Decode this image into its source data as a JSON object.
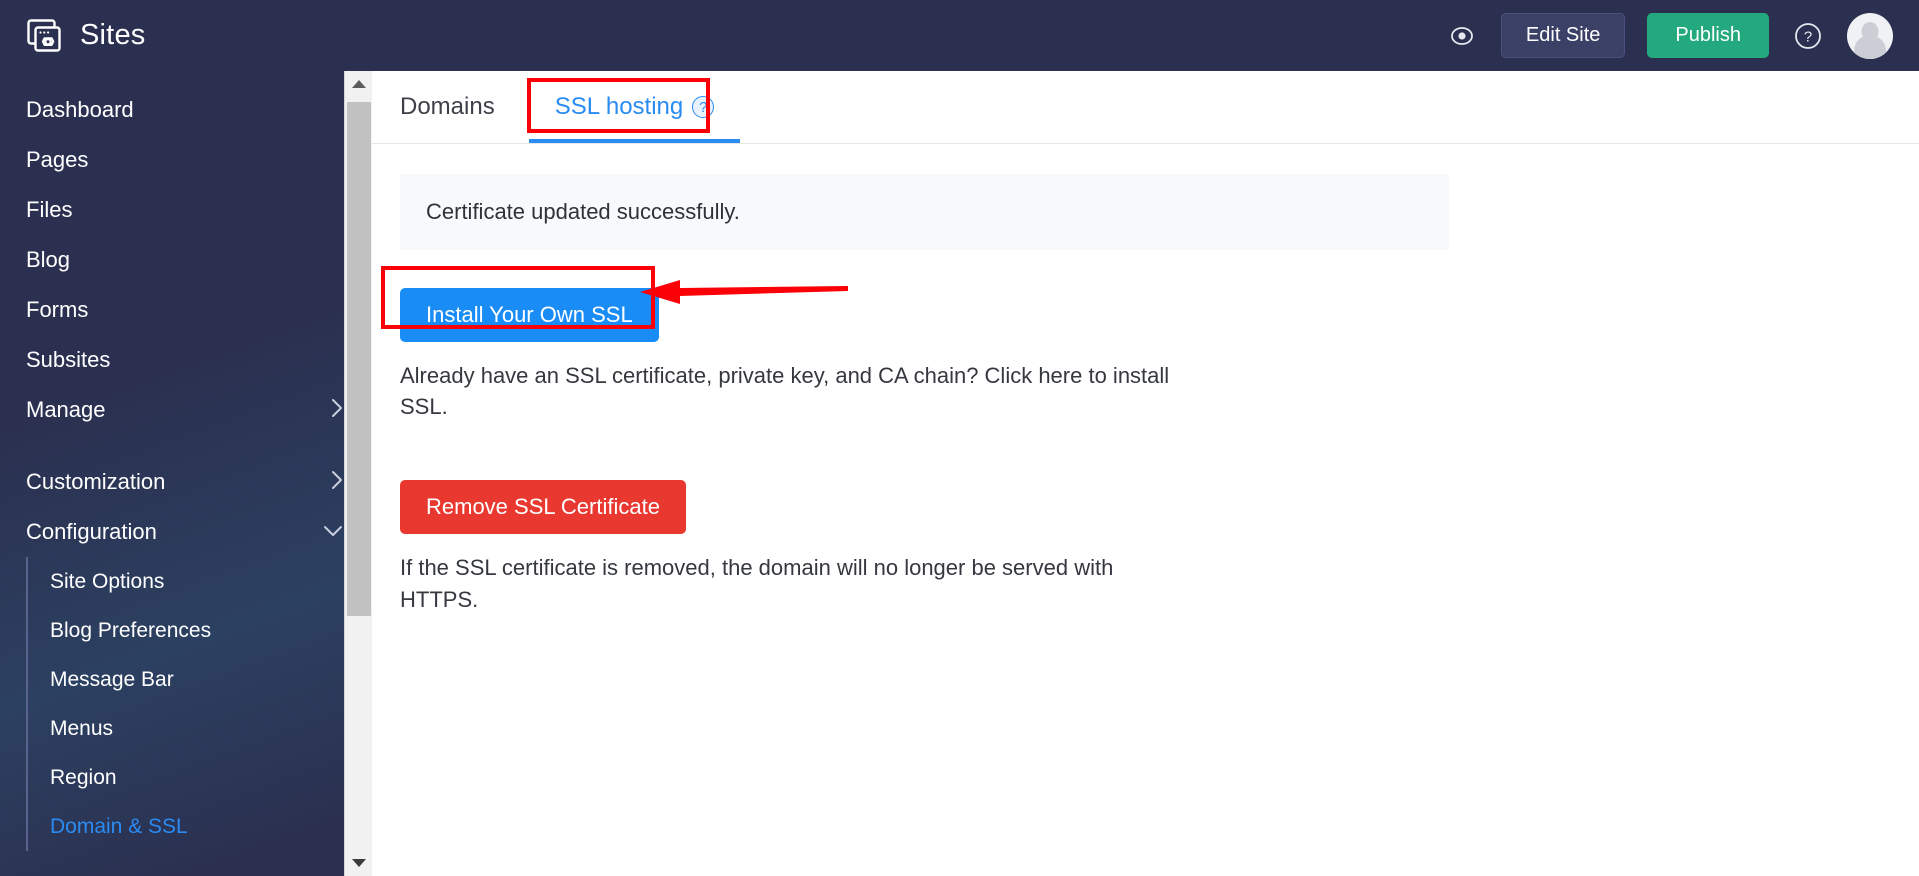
{
  "topbar": {
    "brand_icon": "sites-logo-icon",
    "brand_title": "Sites",
    "preview_icon": "eye-preview-icon",
    "edit_site_label": "Edit Site",
    "publish_label": "Publish",
    "help_icon": "question-mark-icon",
    "avatar_icon": "user-avatar-icon",
    "colors": {
      "bar_bg": "#2b3050",
      "edit_btn_bg": "#3b4066",
      "publish_btn_bg": "#23a97d"
    }
  },
  "sidebar": {
    "items": [
      {
        "label": "Dashboard",
        "chevron": ""
      },
      {
        "label": "Pages",
        "chevron": ""
      },
      {
        "label": "Files",
        "chevron": ""
      },
      {
        "label": "Blog",
        "chevron": ""
      },
      {
        "label": "Forms",
        "chevron": ""
      },
      {
        "label": "Subsites",
        "chevron": ""
      },
      {
        "label": "Manage",
        "chevron": "›"
      },
      {
        "label": "Customization",
        "chevron": "›"
      },
      {
        "label": "Configuration",
        "chevron": "⌄"
      }
    ],
    "submenu": [
      {
        "label": "Site Options",
        "active": false
      },
      {
        "label": "Blog Preferences",
        "active": false
      },
      {
        "label": "Message Bar",
        "active": false
      },
      {
        "label": "Menus",
        "active": false
      },
      {
        "label": "Region",
        "active": false
      },
      {
        "label": "Domain & SSL",
        "active": true
      }
    ],
    "active_color": "#2a8bf2",
    "scrollbar": {
      "up_arrow_icon": "scroll-up-arrow-icon",
      "down_arrow_icon": "scroll-down-arrow-icon",
      "thumb_icon": "scrollbar-thumb"
    }
  },
  "content": {
    "tabs": [
      {
        "label": "Domains",
        "active": false,
        "has_help": false
      },
      {
        "label": "SSL hosting",
        "active": true,
        "has_help": true,
        "help_glyph": "?"
      }
    ],
    "alert": {
      "message": "Certificate updated successfully.",
      "bg": "#f6fafd"
    },
    "install": {
      "button_label": "Install Your Own SSL",
      "button_color": "#1a8cf5",
      "description": "Already have an SSL certificate, private key, and CA chain? Click here to install SSL."
    },
    "remove": {
      "button_label": "Remove SSL Certificate",
      "button_color": "#e8382f",
      "description": "If the SSL certificate is removed, the domain will no longer be served with HTTPS."
    }
  },
  "annotations": {
    "highlight_color": "#fb0007",
    "boxes": [
      {
        "name": "ssl-hosting-tab-highlight"
      },
      {
        "name": "install-your-own-ssl-button-highlight"
      }
    ],
    "arrow": {
      "name": "pointer-arrow-to-install-button"
    }
  }
}
